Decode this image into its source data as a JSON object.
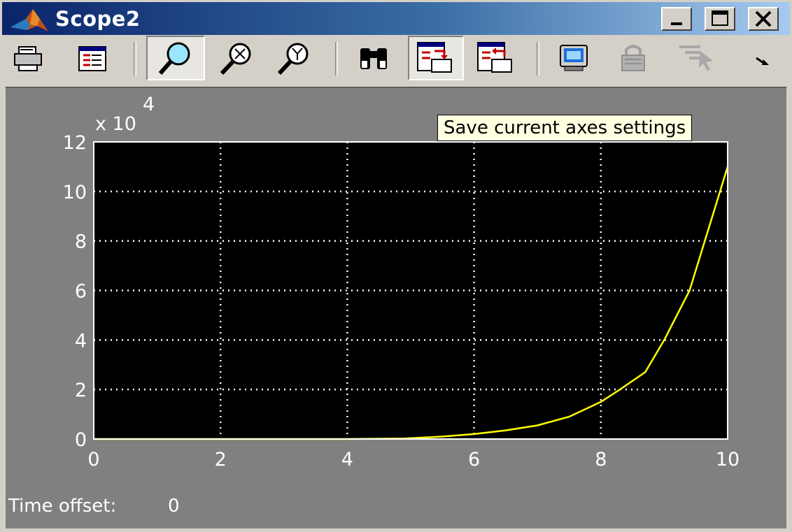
{
  "window": {
    "title": "Scope2",
    "buttons": [
      "minimize-button",
      "maximize-button",
      "close-button"
    ]
  },
  "toolbar": {
    "items": [
      {
        "name": "print-button",
        "icon": "printer-icon",
        "pressed": false,
        "enabled": true
      },
      {
        "name": "parameters-button",
        "icon": "parameters-icon",
        "pressed": false,
        "enabled": true
      },
      {
        "name": "zoom-button",
        "icon": "zoom-magnifier-icon",
        "pressed": true,
        "enabled": true
      },
      {
        "name": "zoom-x-button",
        "icon": "zoom-x-icon",
        "pressed": false,
        "enabled": true
      },
      {
        "name": "zoom-y-button",
        "icon": "zoom-y-icon",
        "pressed": false,
        "enabled": true
      },
      {
        "name": "autoscale-button",
        "icon": "binoculars-icon",
        "pressed": false,
        "enabled": true
      },
      {
        "name": "save-axes-settings-button",
        "icon": "save-axes-icon",
        "pressed": true,
        "enabled": true
      },
      {
        "name": "restore-axes-settings-button",
        "icon": "restore-axes-icon",
        "pressed": false,
        "enabled": true
      },
      {
        "name": "floating-scope-button",
        "icon": "floating-scope-icon",
        "pressed": false,
        "enabled": true
      },
      {
        "name": "lock-axes-button",
        "icon": "lock-icon",
        "pressed": false,
        "enabled": false
      },
      {
        "name": "signal-selection-button",
        "icon": "signal-selection-icon",
        "pressed": false,
        "enabled": false
      },
      {
        "name": "toolbar-overflow-button",
        "icon": "chevron-icon",
        "pressed": false,
        "enabled": true
      }
    ]
  },
  "tooltip": {
    "text": "Save current axes settings"
  },
  "status": {
    "time_offset_label": "Time offset:",
    "time_offset_value": "0"
  },
  "colors": {
    "titlebar_start": "#0a246a",
    "titlebar_end": "#a6caf0",
    "scope_background": "#808080",
    "axes_background": "#000000",
    "signal": "#ffff00",
    "grid": "#ffffff"
  },
  "chart_data": {
    "type": "line",
    "xlim": [
      0,
      10
    ],
    "ylim": [
      0,
      12
    ],
    "x_ticks": [
      "0",
      "2",
      "4",
      "6",
      "8",
      "10"
    ],
    "y_ticks": [
      "0",
      "2",
      "4",
      "6",
      "8",
      "10",
      "12"
    ],
    "y_exponent_label": "x 10",
    "y_exponent_power": "4",
    "grid": true,
    "series": [
      {
        "color": "#ffff00",
        "x": [
          0,
          1,
          2,
          3,
          4,
          4.9,
          5.5,
          6,
          6.5,
          7,
          7.5,
          8,
          8.3,
          8.7,
          9,
          9.4,
          9.7,
          10
        ],
        "y": [
          0,
          0,
          0,
          0,
          0,
          0.02,
          0.1,
          0.2,
          0.35,
          0.55,
          0.9,
          1.5,
          2.0,
          2.7,
          4.0,
          6.0,
          8.5,
          11.0
        ]
      }
    ]
  }
}
